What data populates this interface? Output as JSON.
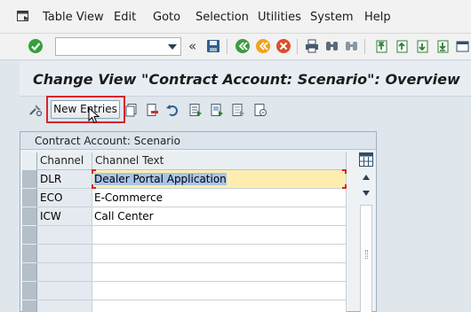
{
  "menubar": {
    "items": [
      "Table View",
      "Edit",
      "Goto",
      "Selection",
      "Utilities",
      "System",
      "Help"
    ],
    "menu_icon": "menu-icon"
  },
  "toolbar": {
    "command_field": {
      "value": "",
      "placeholder": ""
    },
    "icons": [
      "enter-icon",
      "collapse-icon",
      "save-icon",
      "back-icon",
      "exit-icon",
      "cancel-icon",
      "print-icon",
      "find-icon",
      "find-next-icon",
      "first-page-icon",
      "previous-page-icon",
      "next-page-icon",
      "last-page-icon",
      "create-session-icon"
    ]
  },
  "title": "Change View \"Contract Account: Scenario\": Overview",
  "app_toolbar": {
    "new_entries_label": "New Entries",
    "icons": [
      "display-change-icon",
      "copy-icon",
      "delete-icon",
      "undo-icon",
      "select-all-icon",
      "select-block-icon",
      "deselect-all-icon",
      "print-field-list-icon"
    ]
  },
  "table": {
    "caption": "Contract Account: Scenario",
    "columns": [
      "Channel",
      "Channel Text"
    ],
    "rows": [
      {
        "channel": "DLR",
        "text": "Dealer Portal Application"
      },
      {
        "channel": "ECO",
        "text": "E-Commerce"
      },
      {
        "channel": "ICW",
        "text": "Call Center"
      }
    ],
    "settings_icon": "table-settings-icon"
  },
  "colors": {
    "highlight_box": "#d9242b",
    "focused_cell": "#fdeeb0",
    "selected_text": "#a9c4e8",
    "title_bar": "#e7edf2"
  }
}
